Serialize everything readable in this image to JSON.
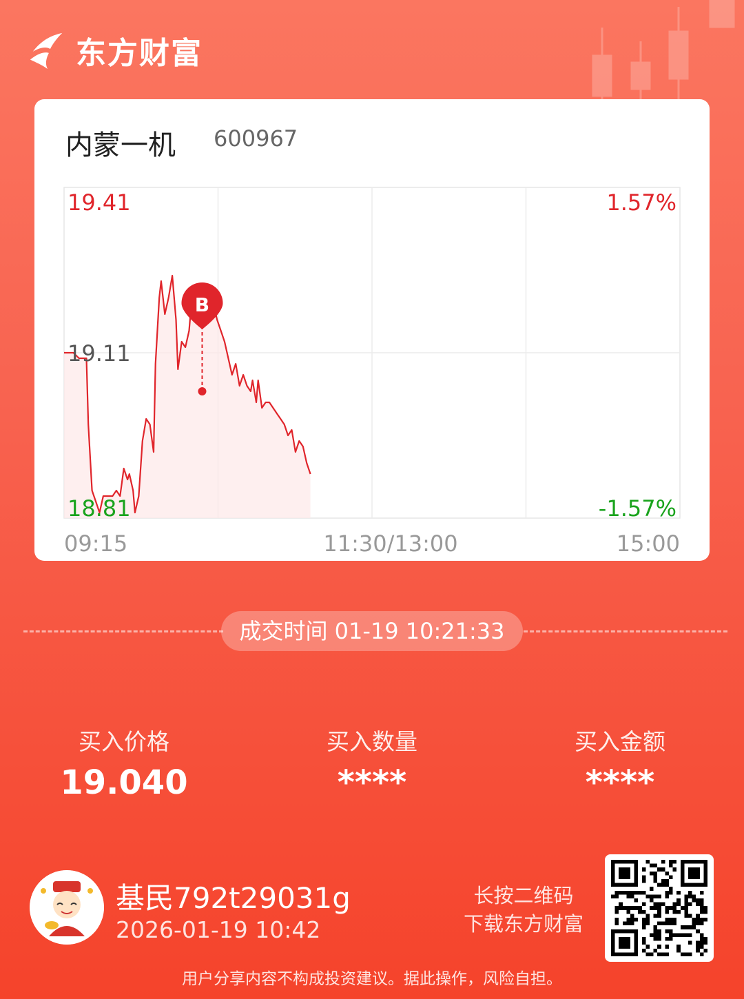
{
  "brand": {
    "name": "东方财富"
  },
  "stock": {
    "name": "内蒙一机",
    "code": "600967"
  },
  "chart_data": {
    "type": "line",
    "title": "",
    "y_left_ticks": [
      "19.41",
      "19.11",
      "18.81"
    ],
    "y_right_ticks": [
      "1.57%",
      "-1.57%"
    ],
    "x_ticks": [
      "09:15",
      "11:30/13:00",
      "15:00"
    ],
    "ylim": [
      18.81,
      19.41
    ],
    "reference_price": 19.11,
    "x_range_minutes": [
      0,
      330
    ],
    "series": [
      {
        "x": [
          0,
          3,
          5,
          8,
          12,
          13,
          15,
          17,
          19,
          21,
          23,
          25,
          26,
          28,
          30,
          32,
          34,
          35,
          37,
          38,
          40,
          42,
          44,
          46,
          48,
          49,
          51,
          52,
          54,
          56,
          58,
          60,
          61,
          63,
          65,
          67,
          68,
          70,
          72,
          74,
          76,
          78,
          80,
          82,
          84,
          86,
          88,
          90,
          92,
          94,
          96,
          98,
          100,
          101,
          103,
          104,
          106,
          108,
          110,
          112,
          114,
          116,
          118,
          120,
          122,
          124,
          126,
          128,
          130,
          132
        ],
        "values": [
          19.11,
          19.11,
          19.11,
          19.1,
          19.1,
          18.98,
          18.86,
          18.84,
          18.82,
          18.85,
          18.85,
          18.85,
          18.85,
          18.86,
          18.85,
          18.9,
          18.88,
          18.89,
          18.86,
          18.82,
          18.85,
          18.95,
          18.99,
          18.98,
          18.93,
          19.09,
          19.21,
          19.24,
          19.18,
          19.21,
          19.25,
          19.17,
          19.08,
          19.13,
          19.12,
          19.15,
          19.19,
          19.2,
          19.19,
          19.2,
          19.19,
          19.2,
          19.2,
          19.17,
          19.15,
          19.13,
          19.1,
          19.07,
          19.09,
          19.05,
          19.07,
          19.05,
          19.04,
          19.06,
          19.02,
          19.06,
          19.01,
          19.02,
          19.02,
          19.01,
          19.0,
          18.99,
          18.98,
          18.96,
          18.97,
          18.93,
          18.95,
          18.94,
          18.91,
          18.89
        ]
      }
    ],
    "marker": {
      "label": "B",
      "x": 74,
      "value": 19.04
    },
    "colors": {
      "up": "#e0252b",
      "down": "#19a31c",
      "neutral": "#555555",
      "fill": "#fde8e8"
    },
    "grid": true
  },
  "trade": {
    "time_label": "成交时间 01-19 10:21:33"
  },
  "stats": {
    "price_label": "买入价格",
    "price_value": "19.040",
    "qty_label": "买入数量",
    "qty_value": "****",
    "amount_label": "买入金额",
    "amount_value": "****"
  },
  "user": {
    "name": "基民792t29031g",
    "time": "2026-01-19 10:42"
  },
  "qr": {
    "hint_line1": "长按二维码",
    "hint_line2": "下载东方财富"
  },
  "disclaimer": "用户分享内容不构成投资建议。据此操作，风险自担。"
}
